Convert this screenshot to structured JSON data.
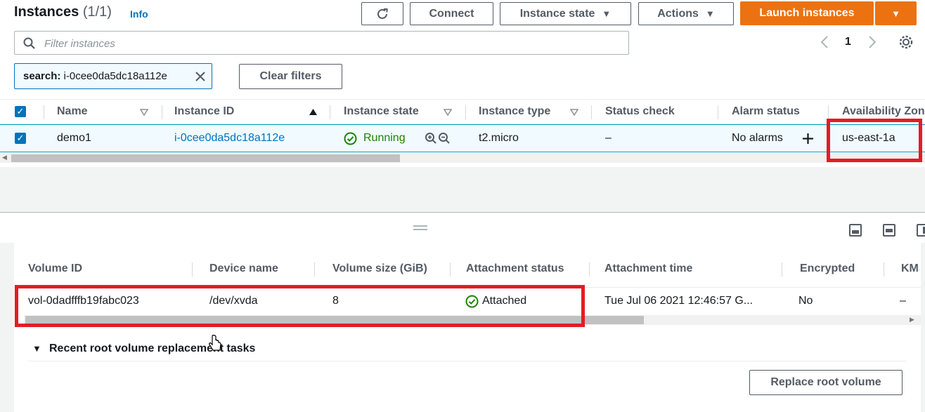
{
  "header": {
    "title": "Instances",
    "count": "(1/1)",
    "info": "Info",
    "buttons": {
      "connect": "Connect",
      "instance_state": "Instance state",
      "actions": "Actions",
      "launch": "Launch instances"
    }
  },
  "filter": {
    "placeholder": "Filter instances",
    "token": "search: i-0cee0da5dc18a112e",
    "token_label": "search:",
    "token_value": "i-0cee0da5dc18a112e",
    "clear": "Clear filters"
  },
  "pagination": {
    "page": "1"
  },
  "instances_table": {
    "columns": [
      "Name",
      "Instance ID",
      "Instance state",
      "Instance type",
      "Status check",
      "Alarm status",
      "Availability Zone"
    ],
    "rows": [
      {
        "name": "demo1",
        "instance_id": "i-0cee0da5dc18a112e",
        "state": "Running",
        "type": "t2.micro",
        "status_check": "–",
        "alarm": "No alarms",
        "az": "us-east-1a"
      }
    ]
  },
  "volumes_table": {
    "columns": [
      "Volume ID",
      "Device name",
      "Volume size (GiB)",
      "Attachment status",
      "Attachment time",
      "Encrypted",
      "KMS"
    ],
    "rows": [
      {
        "volume_id": "vol-0dadfffb19fabc023",
        "device": "/dev/xvda",
        "size": "8",
        "status": "Attached",
        "time": "Tue Jul 06 2021 12:46:57 G...",
        "encrypted": "No",
        "kms": "–"
      }
    ]
  },
  "replacement": {
    "section_title": "Recent root volume replacement tasks",
    "button": "Replace root volume"
  },
  "colors": {
    "accent": "#0073bb",
    "launch": "#ec7211",
    "success": "#1d8102",
    "highlight": "#e41c24"
  }
}
